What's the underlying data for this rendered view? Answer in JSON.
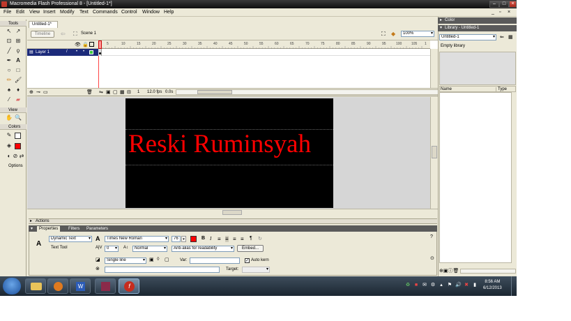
{
  "app": {
    "title": "Macromedia Flash Professional 8 - [Untitled-1*]"
  },
  "menu": [
    "File",
    "Edit",
    "View",
    "Insert",
    "Modify",
    "Text",
    "Commands",
    "Control",
    "Window",
    "Help"
  ],
  "tools": {
    "header": "Tools",
    "view_header": "View",
    "colors_header": "Colors",
    "options_header": "Options"
  },
  "document": {
    "tab": "Untitled-1*",
    "timeline_button": "Timeline",
    "scene": "Scene 1",
    "zoom": "100%"
  },
  "timeline": {
    "layer_name": "Layer 1",
    "ruler": [
      "1",
      "5",
      "10",
      "15",
      "20",
      "25",
      "30",
      "35",
      "40",
      "45",
      "50",
      "55",
      "60",
      "65",
      "70",
      "75",
      "80",
      "85",
      "90",
      "95",
      "100",
      "105",
      "1"
    ],
    "current_frame": "1",
    "fps": "12.0 fps",
    "elapsed": "0.0s"
  },
  "stage": {
    "text": "Reski Ruminsyah",
    "text_color": "#ff0000",
    "background": "#000000"
  },
  "actions_panel": {
    "label": "Actions"
  },
  "properties": {
    "tabs": [
      "Properties",
      "Filters",
      "Parameters"
    ],
    "text_type": "Dynamic Text",
    "tool_label": "Text Tool",
    "font": "Times New Roman",
    "font_size": "76",
    "letter_spacing": "0",
    "baseline": "Normal",
    "anti_alias": "Anti-alias for readability",
    "embed_button": "Embed...",
    "line_type": "Single line",
    "var_label": "Var:",
    "auto_kern": "Auto kern",
    "target_label": "Target:",
    "bold": "B",
    "italic": "I"
  },
  "right_panel": {
    "color_header": "Color",
    "library_header": "Library - Untitled-1",
    "library_select": "Untitled-1",
    "empty_text": "Empty library",
    "col_name": "Name",
    "col_type": "Type"
  },
  "taskbar": {
    "time": "8:56 AM",
    "date": "6/12/2013"
  }
}
